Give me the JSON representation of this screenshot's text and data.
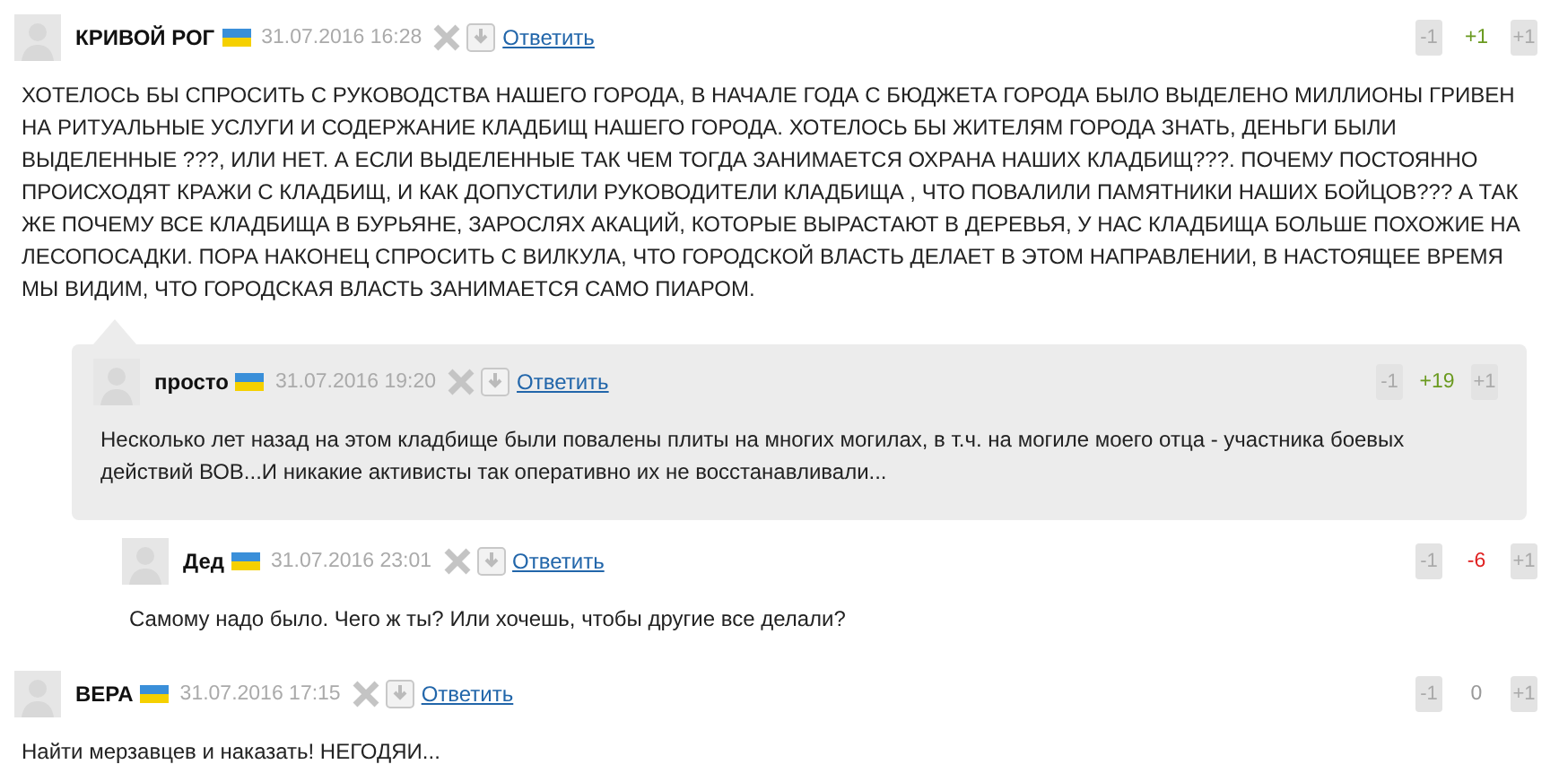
{
  "comments": [
    {
      "author": "КРИВОЙ РОГ",
      "date": "31.07.2016 16:28",
      "reply": "Ответить",
      "down": "-1",
      "score": "+1",
      "color": "#6a9a1f",
      "up": "+1",
      "highlighted": false,
      "text": "ХОТЕЛОСЬ БЫ СПРОСИТЬ С РУКОВОДСТВА НАШЕГО ГОРОДА, В НАЧАЛЕ ГОДА С БЮДЖЕТА ГОРОДА БЫЛО ВЫДЕЛЕНО МИЛЛИОНЫ ГРИВЕН НА РИТУАЛЬНЫЕ УСЛУГИ И СОДЕРЖАНИЕ КЛАДБИЩ НАШЕГО ГОРОДА. ХОТЕЛОСЬ БЫ ЖИТЕЛЯМ ГОРОДА ЗНАТЬ, ДЕНЬГИ БЫЛИ ВЫДЕЛЕННЫЕ ???, ИЛИ НЕТ. А ЕСЛИ ВЫДЕЛЕННЫЕ ТАК ЧЕМ ТОГДА ЗАНИМАЕТСЯ ОХРАНА НАШИХ КЛАДБИЩ???. ПОЧЕМУ ПОСТОЯННО ПРОИСХОДЯТ КРАЖИ С КЛАДБИЩ, И КАК ДОПУСТИЛИ РУКОВОДИТЕЛИ КЛАДБИЩА , ЧТО ПОВАЛИЛИ ПАМЯТНИКИ НАШИХ БОЙЦОВ??? А ТАК ЖЕ ПОЧЕМУ ВСЕ КЛАДБИЩА В БУРЬЯНЕ, ЗАРОСЛЯХ АКАЦИЙ, КОТОРЫЕ ВЫРАСТАЮТ В ДЕРЕВЬЯ, У НАС КЛАДБИЩА БОЛЬШЕ ПОХОЖИЕ НА ЛЕСОПОСАДКИ. ПОРА НАКОНЕЦ СПРОСИТЬ С ВИЛКУЛА, ЧТО ГОРОДСКОЙ ВЛАСТЬ ДЕЛАЕТ В ЭТОМ НАПРАВЛЕНИИ, В НАСТОЯЩЕЕ ВРЕМЯ МЫ ВИДИМ, ЧТО ГОРОДСКАЯ ВЛАСТЬ ЗАНИМАЕТСЯ САМО ПИАРОМ.",
      "children": [
        {
          "author": "просто",
          "date": "31.07.2016 19:20",
          "reply": "Ответить",
          "down": "-1",
          "score": "+19",
          "color": "#6a9a1f",
          "up": "+1",
          "highlighted": true,
          "text": "Несколько лет назад на этом кладбище были повалены плиты на многих могилах, в т.ч. на могиле моего отца - участника боевых действий ВОВ...И никакие активисты так оперативно их не восстанавливали...",
          "children": [
            {
              "author": "Дед",
              "date": "31.07.2016 23:01",
              "reply": "Ответить",
              "down": "-1",
              "score": "-6",
              "color": "#e02020",
              "up": "+1",
              "highlighted": false,
              "text": "Самому надо было. Чего ж ты? Или хочешь, чтобы другие все делали?"
            }
          ]
        }
      ]
    },
    {
      "author": "ВЕРА",
      "date": "31.07.2016 17:15",
      "reply": "Ответить",
      "down": "-1",
      "score": "0",
      "color": "#999999",
      "up": "+1",
      "highlighted": false,
      "text": "Найти мерзавцев и наказать! НЕГОДЯИ..."
    }
  ]
}
